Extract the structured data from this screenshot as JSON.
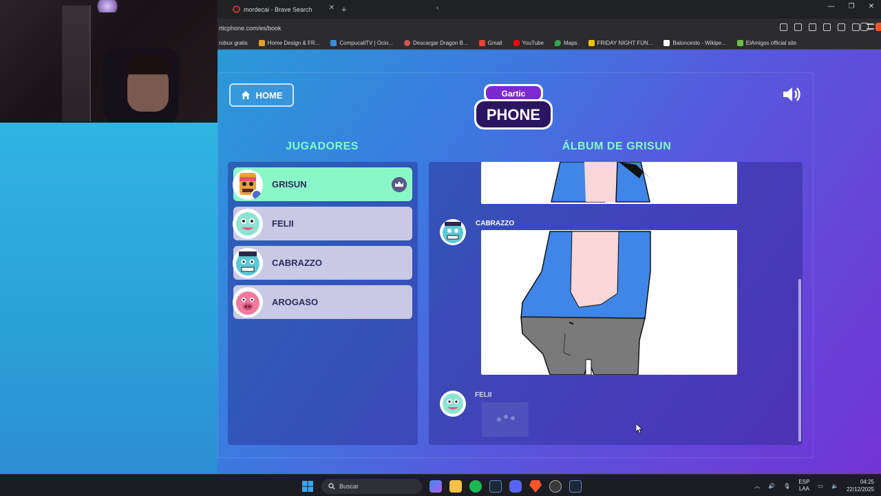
{
  "browser": {
    "tab_title": "mordecai - Brave Search",
    "url": "rticphone.com/es/book",
    "bookmarks": [
      {
        "label": "robux gratis",
        "color": "#2b2b30"
      },
      {
        "label": "Home Design & FR...",
        "color": "#e0a12a"
      },
      {
        "label": "CompucaliTV | Ocio...",
        "color": "#3b8bd8"
      },
      {
        "label": "Descargar Dragon B...",
        "color": "#d9534f"
      },
      {
        "label": "Gmail",
        "color": "#ea4335"
      },
      {
        "label": "YouTube",
        "color": "#ff0000"
      },
      {
        "label": "Maps",
        "color": "#34a853"
      },
      {
        "label": "FRIDAY NIGHT FUN...",
        "color": "#f4c20d"
      },
      {
        "label": "Baloncesto - Wikipe...",
        "color": "#ffffff"
      },
      {
        "label": "ElAmigos official site",
        "color": "#6fbf3f"
      }
    ]
  },
  "game": {
    "home_label": "HOME",
    "logo_top": "Gartic",
    "logo_bottom": "PHONE",
    "players_heading": "JUGADORES",
    "album_heading": "ÁLBUM DE GRISUN",
    "players": [
      {
        "name": "GRISUN",
        "active": true,
        "host": true,
        "avatar_color": "#e84d7a"
      },
      {
        "name": "FELII",
        "active": false,
        "host": false,
        "avatar_color": "#8de3d2"
      },
      {
        "name": "CABRAZZO",
        "active": false,
        "host": false,
        "avatar_color": "#5bc9d6"
      },
      {
        "name": "AROGASO",
        "active": false,
        "host": false,
        "avatar_color": "#f07a9e"
      }
    ],
    "album_entries": [
      {
        "author": "CABRAZZO",
        "type": "drawing"
      },
      {
        "author": "FELII",
        "type": "loading"
      }
    ]
  },
  "taskbar": {
    "search_placeholder": "Buscar",
    "lang_top": "ESP",
    "lang_bottom": "LAA",
    "time": "04:25",
    "date": "22/12/2025"
  }
}
